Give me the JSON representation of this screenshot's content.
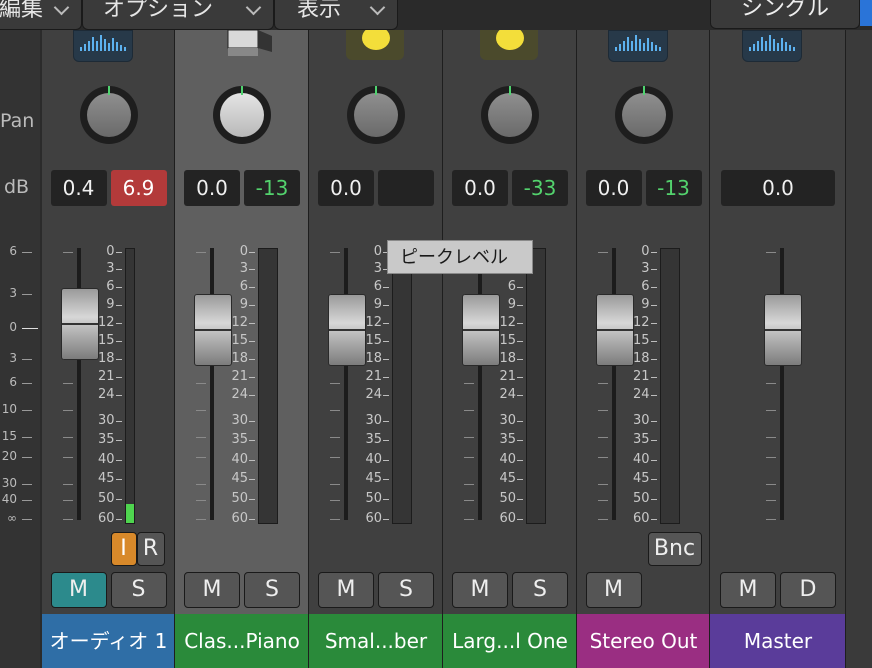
{
  "top_menu": {
    "edit_label": "編集",
    "options_label": "オプション",
    "view_label": "表示",
    "single_label": "シングル"
  },
  "row_labels": {
    "pan": "Pan",
    "db": "dB"
  },
  "scale_labels": [
    "6",
    "3",
    "0",
    "3",
    "6",
    "10",
    "15",
    "20",
    "30",
    "40",
    "∞"
  ],
  "strips": [
    {
      "name": "オーディオ 1",
      "name_color": "#2f6ea6",
      "pan_value": "0.4",
      "db_value": "6.9",
      "db_value_style": "red",
      "mute": "M",
      "solo": "S",
      "mute_active": true,
      "input": "I",
      "record": "R",
      "meter_level": 0.07
    },
    {
      "name": "Clas...Piano",
      "name_color": "#2a8a3a",
      "pan_value": "0.0",
      "db_value": "-13",
      "db_value_style": "green",
      "mute": "M",
      "solo": "S",
      "mute_active": false,
      "meter_level": 0
    },
    {
      "name": "Smal...ber",
      "name_color": "#2a8a3a",
      "pan_value": "0.0",
      "db_value": "",
      "db_value_style": "plain",
      "mute": "M",
      "solo": "S",
      "mute_active": false,
      "meter_level": 0
    },
    {
      "name": "Larg...l One",
      "name_color": "#2a8a3a",
      "pan_value": "0.0",
      "db_value": "-33",
      "db_value_style": "green",
      "mute": "M",
      "solo": "S",
      "mute_active": false,
      "meter_level": 0
    },
    {
      "name": "Stereo Out",
      "name_color": "#9a2e82",
      "pan_value": "0.0",
      "db_value": "-13",
      "db_value_style": "green",
      "mute": "M",
      "bounce": "Bnc",
      "mute_active": false,
      "meter_level": 0
    },
    {
      "name": "Master",
      "name_color": "#5a3c9a",
      "pan_value": "",
      "db_value": "0.0",
      "db_value_style": "plain",
      "mute": "M",
      "dim": "D",
      "mute_active": false
    }
  ],
  "meter_scale": [
    "0",
    "3",
    "6",
    "9",
    "12",
    "15",
    "18",
    "21",
    "24",
    "30",
    "35",
    "40",
    "45",
    "50",
    "60"
  ],
  "tooltip": "ピークレベル"
}
